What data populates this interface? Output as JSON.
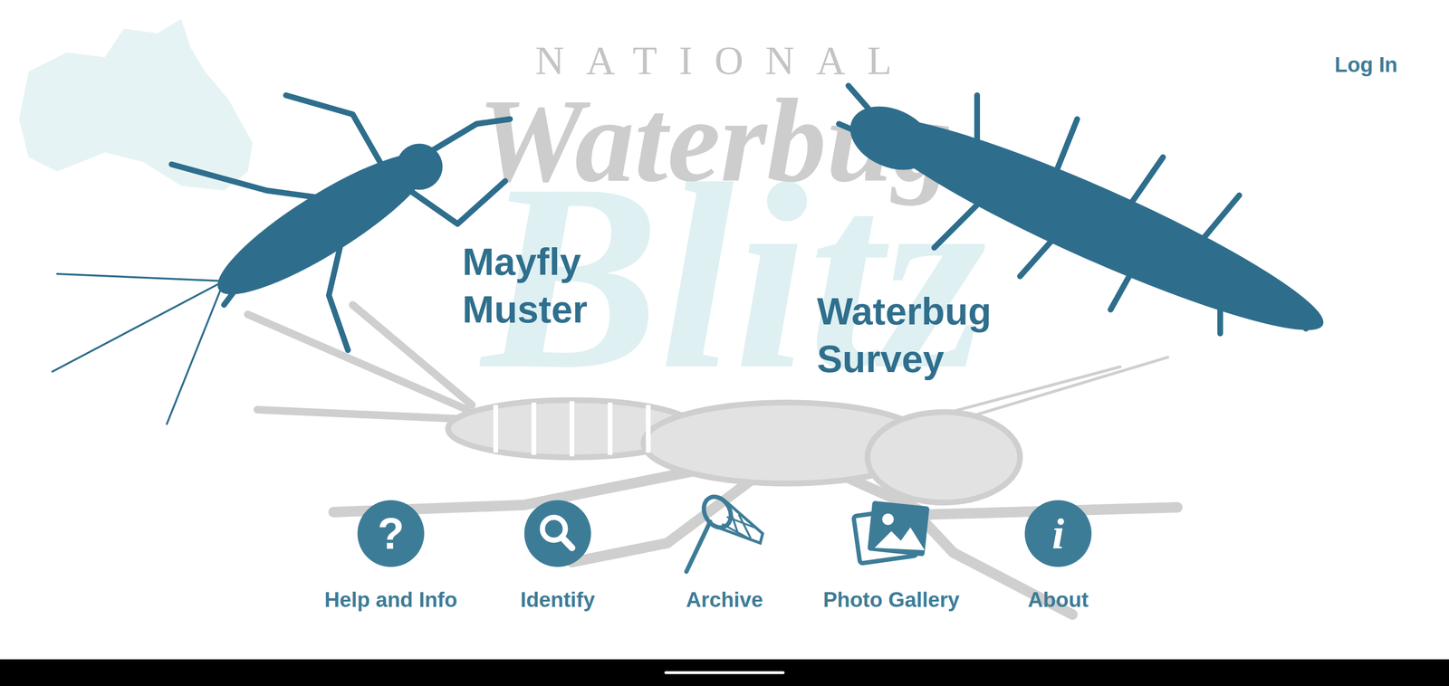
{
  "header": {
    "national": "NATIONAL",
    "title": "Waterbug",
    "subtitle": "Blitz",
    "login": "Log In"
  },
  "menu": [
    {
      "label": "Mayfly Muster"
    },
    {
      "label": "Waterbug Survey"
    }
  ],
  "nav": [
    {
      "label": "Help and Info",
      "icon": "?",
      "kind": "circle"
    },
    {
      "label": "Identify",
      "kind": "search"
    },
    {
      "label": "Archive",
      "kind": "net"
    },
    {
      "label": "Photo Gallery",
      "kind": "photos"
    },
    {
      "label": "About",
      "icon": "i",
      "kind": "circle"
    }
  ]
}
